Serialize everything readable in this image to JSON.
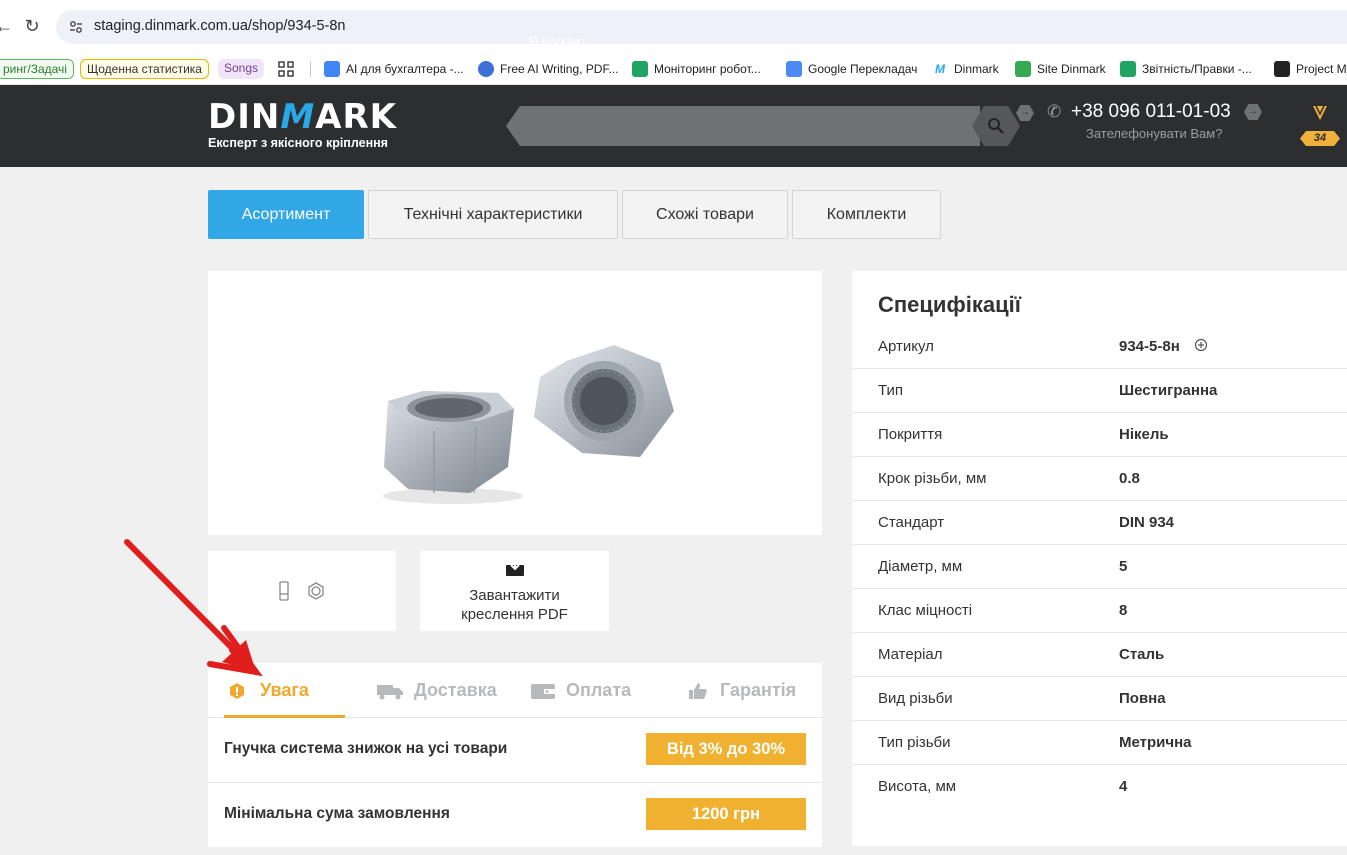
{
  "browser": {
    "url": "staging.dinmark.com.ua/shop/934-5-8n",
    "back_icon": "arrow-left-icon",
    "reload_icon": "reload-icon",
    "bookmarks": [
      {
        "label": "ринг/Задачі"
      },
      {
        "label": "Щоденна статистика"
      },
      {
        "label": "Songs"
      },
      {
        "label": "AI для бухгалтера -..."
      },
      {
        "label": "Free AI Writing, PDF..."
      },
      {
        "label": "Моніторинг робот..."
      },
      {
        "label": "Google Перекладач"
      },
      {
        "label": "Dinmark"
      },
      {
        "label": "Site Dinmark"
      },
      {
        "label": "Звітність/Правки -..."
      },
      {
        "label": "Project M"
      }
    ]
  },
  "header": {
    "logo_part1": "DIN",
    "logo_part2": "M",
    "logo_part3": "ARK",
    "tagline": "Експерт з якісного кріплення",
    "search_placeholder": "Я шукаю",
    "phone": "+38 096 011-01-03",
    "callback": "Зателефонувати Вам?",
    "cart_count": "34"
  },
  "tabs": [
    {
      "label": "Асортимент",
      "active": true
    },
    {
      "label": "Технічні характеристики"
    },
    {
      "label": "Схожі товари"
    },
    {
      "label": "Комплекти"
    }
  ],
  "download": {
    "label_line1": "Завантажити",
    "label_line2": "креслення PDF"
  },
  "info": {
    "tabs": [
      {
        "label": "Увага",
        "icon": "warning-icon",
        "active": true
      },
      {
        "label": "Доставка",
        "icon": "truck-icon"
      },
      {
        "label": "Оплата",
        "icon": "wallet-icon"
      },
      {
        "label": "Гарантія",
        "icon": "thumbs-up-icon"
      }
    ],
    "rows": [
      {
        "label": "Гнучка система знижок на усі товари",
        "value": "Від 3% до 30%"
      },
      {
        "label": "Мінімальна сума замовлення",
        "value": "1200 грн"
      }
    ]
  },
  "specs": {
    "title": "Специфікації",
    "rows": [
      {
        "key": "Артикул",
        "value": "934-5-8н"
      },
      {
        "key": "Тип",
        "value": "Шестигранна"
      },
      {
        "key": "Покриття",
        "value": "Нікель"
      },
      {
        "key": "Крок різьби, мм",
        "value": "0.8"
      },
      {
        "key": "Стандарт",
        "value": "DIN 934"
      },
      {
        "key": "Діаметр, мм",
        "value": "5"
      },
      {
        "key": "Клас міцності",
        "value": "8"
      },
      {
        "key": "Матеріал",
        "value": "Сталь"
      },
      {
        "key": "Вид різьби",
        "value": "Повна"
      },
      {
        "key": "Тип різьби",
        "value": "Метрична"
      },
      {
        "key": "Висота, мм",
        "value": "4"
      }
    ]
  },
  "colors": {
    "accent_blue": "#31a7e6",
    "accent_orange": "#f0b030",
    "header_bg": "#2c2e30",
    "arrow": "#e01e1e"
  }
}
